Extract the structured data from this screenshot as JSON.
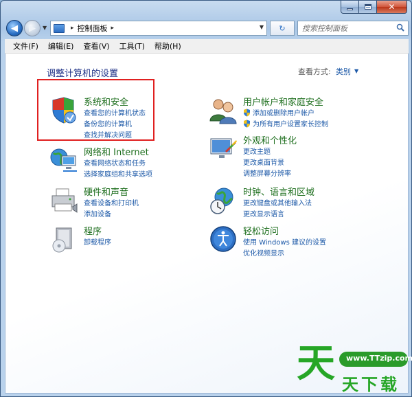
{
  "window": {
    "address": {
      "location": "控制面板"
    },
    "search": {
      "placeholder": "搜索控制面板"
    }
  },
  "menu": [
    "文件(F)",
    "编辑(E)",
    "查看(V)",
    "工具(T)",
    "帮助(H)"
  ],
  "content": {
    "heading": "调整计算机的设置",
    "view_by_label": "查看方式:",
    "view_by_value": "类别"
  },
  "categories": [
    {
      "title": "系统和安全",
      "icon": "shield-icon",
      "links": [
        "查看您的计算机状态",
        "备份您的计算机",
        "查找并解决问题"
      ],
      "highlighted": true
    },
    {
      "title": "用户帐户和家庭安全",
      "icon": "users-icon",
      "links": [
        "添加或删除用户帐户",
        "为所有用户设置家长控制"
      ]
    },
    {
      "title": "网络和 Internet",
      "icon": "network-icon",
      "links": [
        "查看网络状态和任务",
        "选择家庭组和共享选项"
      ]
    },
    {
      "title": "外观和个性化",
      "icon": "appearance-icon",
      "links": [
        "更改主题",
        "更改桌面背景",
        "调整屏幕分辨率"
      ]
    },
    {
      "title": "硬件和声音",
      "icon": "printer-icon",
      "links": [
        "查看设备和打印机",
        "添加设备"
      ]
    },
    {
      "title": "时钟、语言和区域",
      "icon": "globe-clock-icon",
      "links": [
        "更改键盘或其他输入法",
        "更改显示语言"
      ]
    },
    {
      "title": "程序",
      "icon": "programs-icon",
      "links": [
        "卸载程序"
      ]
    },
    {
      "title": "轻松访问",
      "icon": "ease-of-access-icon",
      "links": [
        "使用 Windows 建议的设置",
        "优化视频显示"
      ]
    }
  ],
  "watermark": {
    "url": "www.TTzip.com",
    "big_char": "天",
    "small_text": "天下载"
  }
}
